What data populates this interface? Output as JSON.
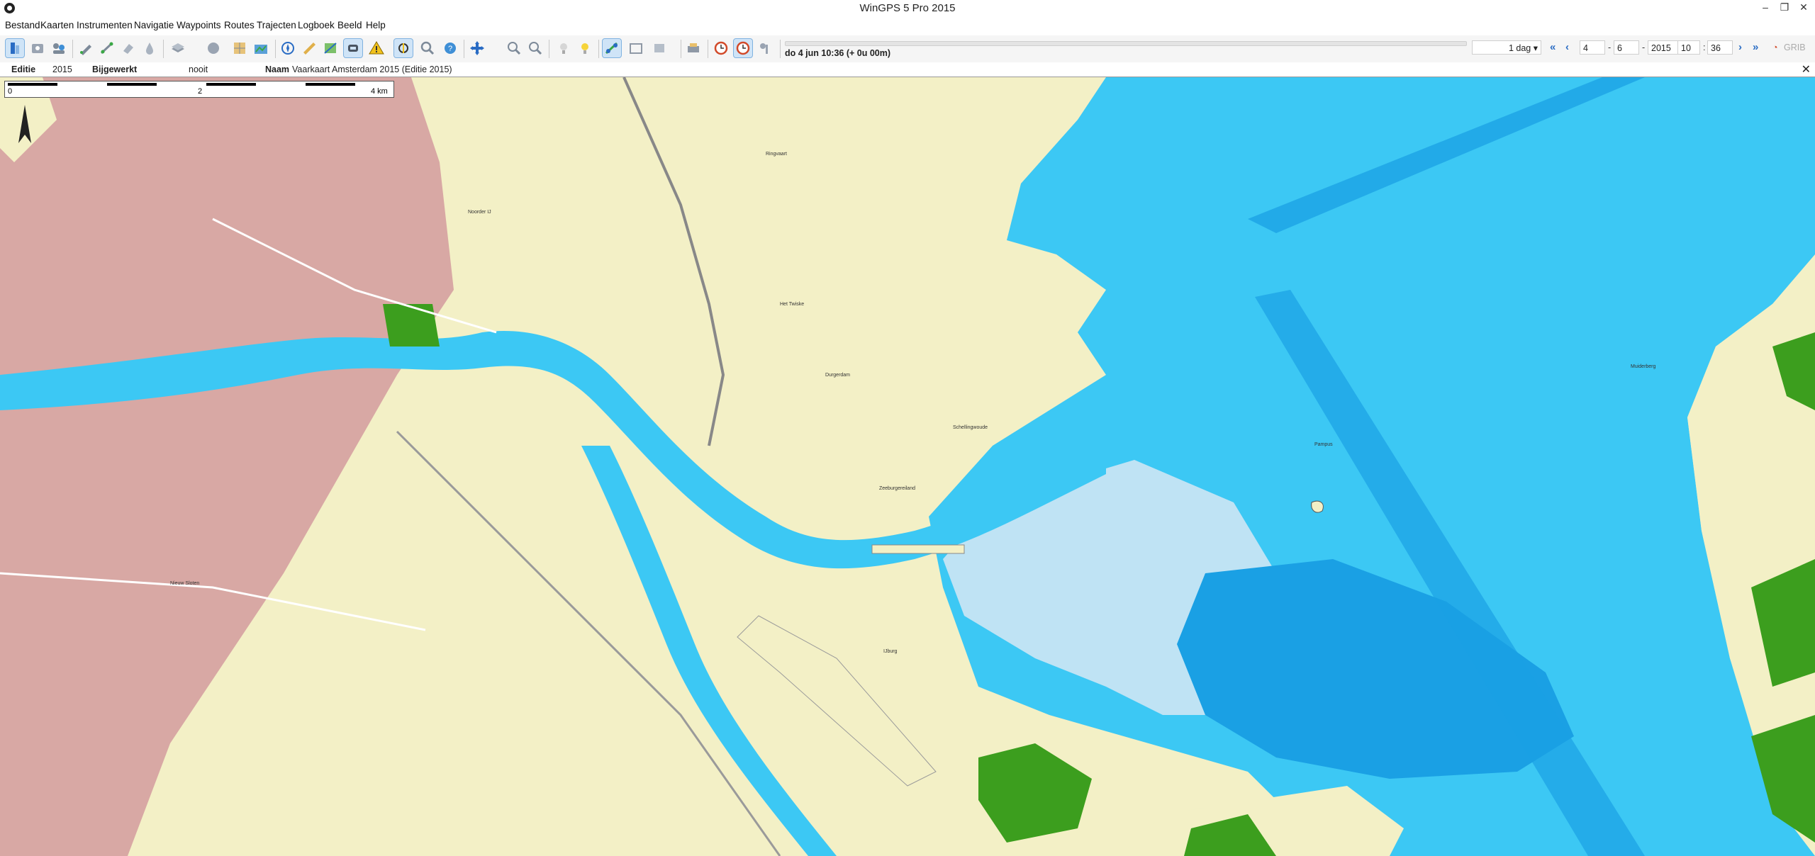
{
  "window": {
    "title": "WinGPS 5 Pro 2015"
  },
  "menu": [
    "Bestand",
    "Kaarten",
    "Instrumenten",
    "Navigatie",
    "Waypoints",
    "Routes",
    "Trajecten",
    "Logboek",
    "Beeld",
    "Help"
  ],
  "toolbar": {
    "time_label": "do 4 jun 10:36  (+ 0u 00m)",
    "step": "1 dag",
    "day": "4",
    "month": "6",
    "year": "2015",
    "hour": "10",
    "minute": "36",
    "grib_label": "GRIB"
  },
  "infobar": {
    "edition_label": "Editie",
    "edition_value": "2015",
    "updated_label": "Bijgewerkt",
    "updated_value": "nooit",
    "name_label": "Naam",
    "name_value": "Vaarkaart Amsterdam 2015 (Editie 2015)"
  },
  "scale": {
    "zero": "0",
    "mid": "2",
    "end": "4 km"
  },
  "map_labels": [
    "Noorder IJ",
    "Ringvaart",
    "Pampus",
    "Durgerdam",
    "Schellingwoude",
    "Zeeburgereiland",
    "IJburg",
    "Nieuw Sloten",
    "Het Twiske",
    "Muiderberg"
  ],
  "colors": {
    "land": "#f3f0c6",
    "city": "#d8a8a4",
    "water_shallow": "#bfe3f4",
    "water_mid": "#58c8f2",
    "water_deep": "#1aa0e4",
    "green": "#3c9e1e",
    "toolbar_bg": "#f5f5f5"
  }
}
